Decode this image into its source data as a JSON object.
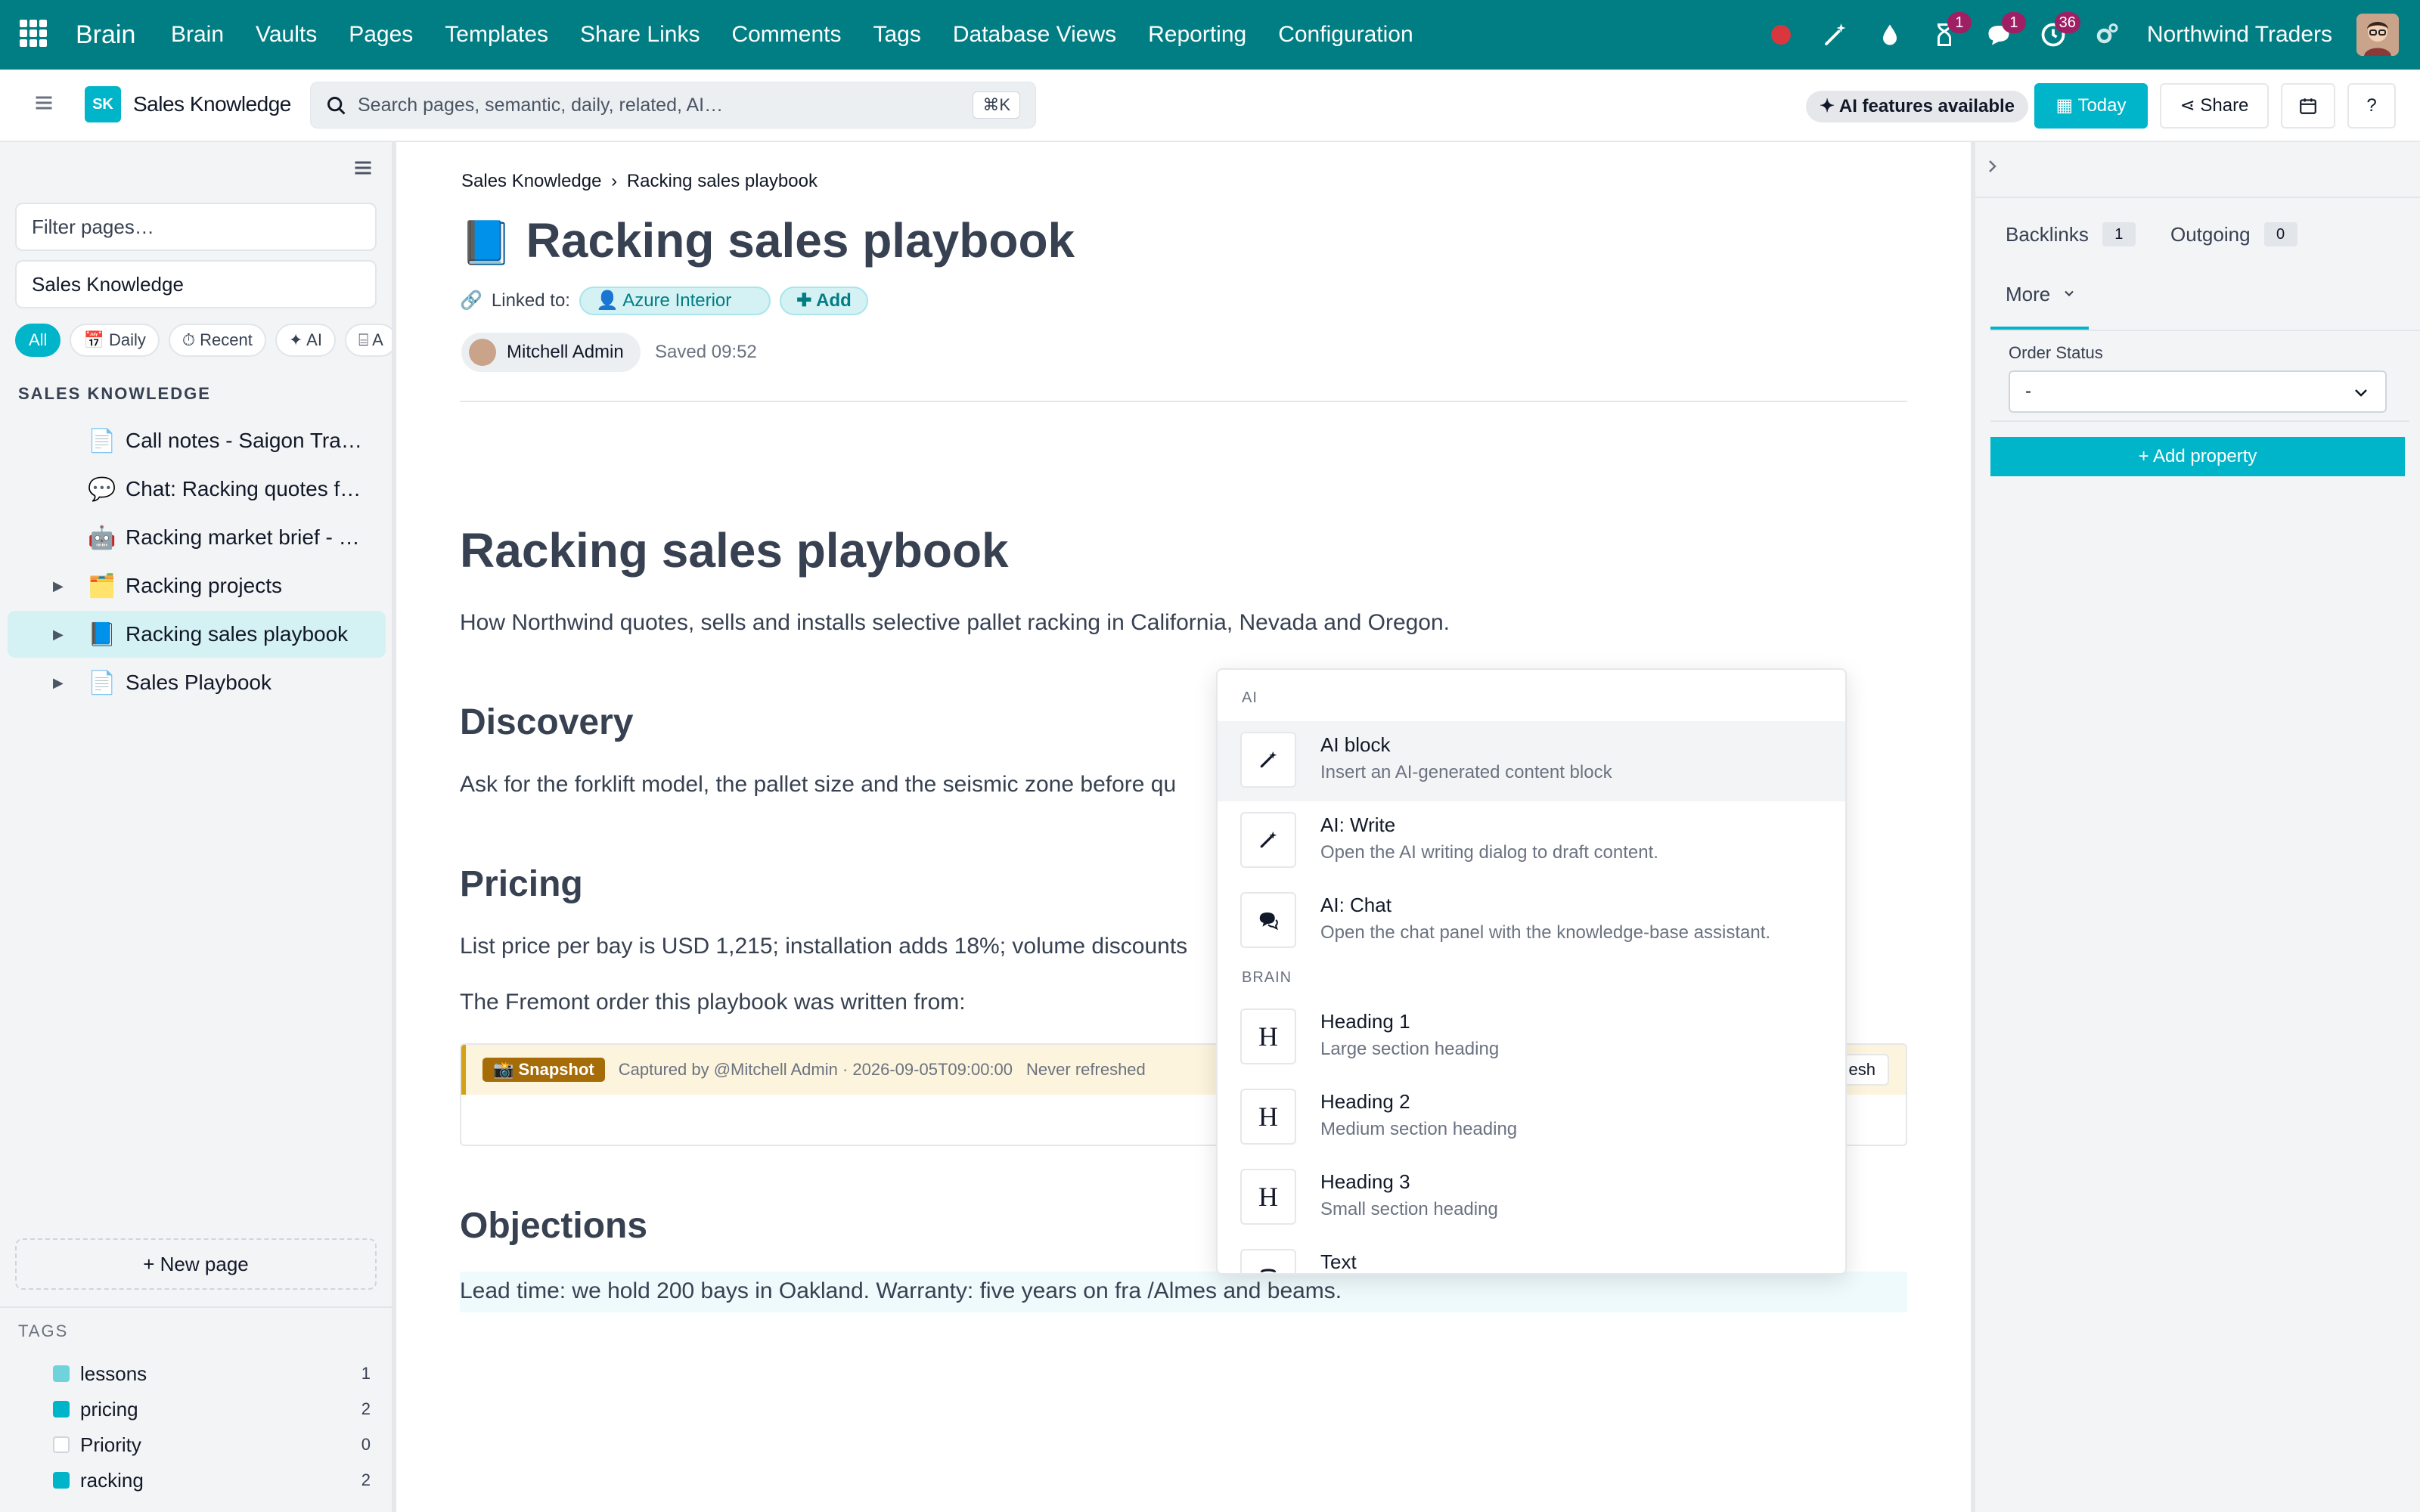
{
  "topbar": {
    "brand": "Brain",
    "menu": [
      "Brain",
      "Vaults",
      "Pages",
      "Templates",
      "Share Links",
      "Comments",
      "Tags",
      "Database Views",
      "Reporting",
      "Configuration"
    ],
    "badges": {
      "activity": "1",
      "messages": "1",
      "clock": "36"
    },
    "company": "Northwind Traders"
  },
  "subbar": {
    "vault_initials": "SK",
    "vault_name": "Sales Knowledge",
    "search_placeholder": "Search pages, semantic, daily, related, AI…",
    "search_shortcut": "⌘K",
    "ai_badge": "✦ AI features available",
    "today_label": "Today",
    "share_label": "Share",
    "help_label": "?"
  },
  "sidebar": {
    "filter_placeholder": "Filter pages…",
    "vault_value": "Sales Knowledge",
    "chips": [
      "All",
      "📅 Daily",
      "⏱ Recent",
      "✦ AI",
      "⌸ A"
    ],
    "section_title": "SALES KNOWLEDGE",
    "items": [
      {
        "icon": "📄",
        "label": "Call notes - Saigon Tradi…",
        "caret": ""
      },
      {
        "icon": "💬",
        "label": "Chat: Racking quotes for…",
        "caret": ""
      },
      {
        "icon": "🤖",
        "label": "Racking market brief - Se…",
        "caret": ""
      },
      {
        "icon": "🗂️",
        "label": "Racking projects",
        "caret": "▶"
      },
      {
        "icon": "📘",
        "label": "Racking sales playbook",
        "caret": "▶"
      },
      {
        "icon": "📄",
        "label": "Sales Playbook",
        "caret": "▶"
      }
    ],
    "new_page": "+ New page",
    "tags_title": "TAGS",
    "tags": [
      {
        "name": "lessons",
        "count": "1",
        "color": "#6fd3dc"
      },
      {
        "name": "pricing",
        "count": "2",
        "color": "#00b5c9"
      },
      {
        "name": "Priority",
        "count": "0",
        "color": "#ffffff"
      },
      {
        "name": "racking",
        "count": "2",
        "color": "#00b5c9"
      }
    ]
  },
  "page": {
    "breadcrumb_root": "Sales Knowledge",
    "breadcrumb_sep": "›",
    "breadcrumb_current": "Racking sales playbook",
    "title_icon": "📘",
    "title": "Racking sales playbook",
    "linked_label": "Linked to:",
    "linked_partner": "Azure Interior",
    "add_link": "✚ Add",
    "author": "Mitchell Admin",
    "saved": "Saved 09:52"
  },
  "body": {
    "heading": "Racking sales playbook",
    "intro": "How Northwind quotes, sells and installs selective pallet racking in California, Nevada and Oregon.",
    "discovery_h": "Discovery",
    "discovery_p": "Ask for the forklift model, the pallet size and the seismic zone before qu",
    "pricing_h": "Pricing",
    "pricing_p": "List price per bay is USD 1,215; installation adds 18%; volume discounts",
    "fremont_p": "The Fremont order this playbook was written from:",
    "snapshot_badge": "📸 Snapshot",
    "snapshot_meta": "Captured by @Mitchell Admin · 2026-09-05T09:00:00",
    "snapshot_status": "Never refreshed",
    "snapshot_refresh": "esh",
    "objections_h": "Objections",
    "objections_p": "Lead time: we hold 200 bays in Oakland. Warranty: five years on fra /Almes and beams."
  },
  "popup": {
    "sections": [
      "AI",
      "BRAIN"
    ],
    "items": [
      {
        "title": "AI block",
        "desc": "Insert an AI-generated content block",
        "icon": "wand-icon"
      },
      {
        "title": "AI: Write",
        "desc": "Open the AI writing dialog to draft content.",
        "icon": "wand-icon"
      },
      {
        "title": "AI: Chat",
        "desc": "Open the chat panel with the knowledge-base assistant.",
        "icon": "chat-icon"
      },
      {
        "title": "Heading 1",
        "desc": "Large section heading",
        "icon": "H"
      },
      {
        "title": "Heading 2",
        "desc": "Medium section heading",
        "icon": "H"
      },
      {
        "title": "Heading 3",
        "desc": "Small section heading",
        "icon": "H"
      },
      {
        "title": "Text",
        "desc": "",
        "icon": "text-icon"
      }
    ]
  },
  "rightpanel": {
    "backlinks_label": "Backlinks",
    "backlinks_count": "1",
    "outgoing_label": "Outgoing",
    "outgoing_count": "0",
    "more_label": "More",
    "order_status_label": "Order Status",
    "order_status_value": "-",
    "add_property": "+ Add property"
  },
  "colors": {
    "topbar": "#017e84",
    "accent": "#00b5c9",
    "snapshot": "#a56c08"
  }
}
